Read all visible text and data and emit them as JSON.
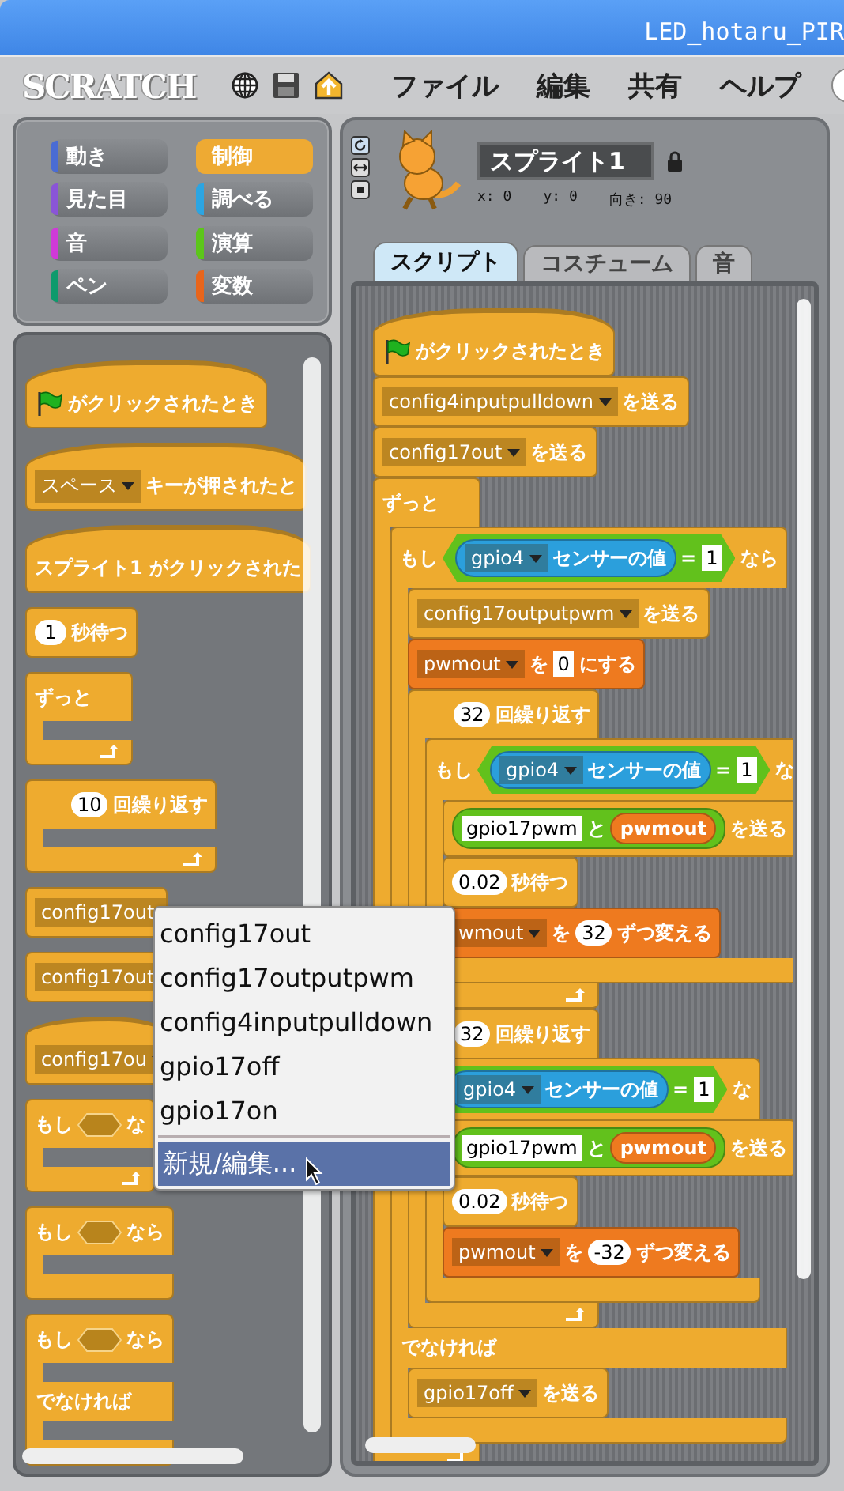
{
  "window": {
    "title": "LED_hotaru_PIR"
  },
  "menubar": {
    "logo": "SCRATCH",
    "menus": [
      "ファイル",
      "編集",
      "共有",
      "ヘルプ"
    ]
  },
  "categories": [
    {
      "label": "動き",
      "color": "#4a6cd4",
      "selected": false
    },
    {
      "label": "制御",
      "color": "#eeaa33",
      "selected": true
    },
    {
      "label": "見た目",
      "color": "#8a55d7",
      "selected": false
    },
    {
      "label": "調べる",
      "color": "#2ca5e2",
      "selected": false
    },
    {
      "label": "音",
      "color": "#cf3ad8",
      "selected": false
    },
    {
      "label": "演算",
      "color": "#5cc61a",
      "selected": false
    },
    {
      "label": "ペン",
      "color": "#0e9a6c",
      "selected": false
    },
    {
      "label": "変数",
      "color": "#e8651b",
      "selected": false
    }
  ],
  "palette": [
    {
      "kind": "hat",
      "color": "#eeab2f",
      "parts": [
        {
          "kind": "flag"
        },
        {
          "kind": "text",
          "text": "がクリックされたとき"
        }
      ]
    },
    {
      "kind": "hat",
      "color": "#eeab2f",
      "parts": [
        {
          "kind": "dropdown",
          "text": "スペース"
        },
        {
          "kind": "text",
          "text": "キーが押されたと"
        }
      ]
    },
    {
      "kind": "hat",
      "color": "#eeab2f",
      "parts": [
        {
          "kind": "text",
          "text": "スプライト1 がクリックされた"
        }
      ]
    },
    {
      "kind": "command",
      "color": "#eeab2f",
      "parts": [
        {
          "kind": "number",
          "text": "1"
        },
        {
          "kind": "text",
          "text": "秒待つ"
        }
      ]
    },
    {
      "kind": "loop",
      "color": "#eeab2f",
      "parts": [
        {
          "kind": "text",
          "text": "ずっと"
        }
      ]
    },
    {
      "kind": "loop",
      "color": "#eeab2f",
      "parts": [
        {
          "kind": "number",
          "text": "10"
        },
        {
          "kind": "text",
          "text": "回繰り返す"
        }
      ]
    },
    {
      "kind": "command",
      "color": "#eeab2f",
      "parts": [
        {
          "kind": "dropdown",
          "text": "config17out"
        }
      ]
    },
    {
      "kind": "command",
      "color": "#eeab2f",
      "parts": [
        {
          "kind": "dropdown",
          "text": "config17out"
        }
      ]
    },
    {
      "kind": "hat",
      "color": "#eeab2f",
      "parts": [
        {
          "kind": "dropdown",
          "text": "config17ou"
        }
      ]
    },
    {
      "kind": "loop",
      "color": "#eeab2f",
      "parts": [
        {
          "kind": "text",
          "text": "もし"
        },
        {
          "kind": "slot"
        },
        {
          "kind": "text",
          "text": "な"
        }
      ]
    },
    {
      "kind": "if",
      "color": "#eeab2f",
      "parts": [
        {
          "kind": "text",
          "text": "もし"
        },
        {
          "kind": "slot"
        },
        {
          "kind": "text",
          "text": "なら"
        }
      ]
    },
    {
      "kind": "ifelse",
      "color": "#eeab2f",
      "parts": [
        {
          "kind": "text",
          "text": "もし"
        },
        {
          "kind": "slot"
        },
        {
          "kind": "text",
          "text": "なら"
        }
      ],
      "else_label": "でなければ"
    }
  ],
  "sprite": {
    "name": "スプライト1",
    "x": "x: 0",
    "y": "y: 0",
    "direction": "向き: 90"
  },
  "tabs": [
    {
      "label": "スクリプト",
      "selected": true
    },
    {
      "label": "コスチューム",
      "selected": false
    },
    {
      "label": "音",
      "selected": false
    }
  ],
  "scripts": [
    {
      "kind": "hat",
      "color": "#eeab2f",
      "parts": [
        {
          "kind": "flag"
        },
        {
          "kind": "text",
          "text": "がクリックされたとき"
        }
      ]
    },
    {
      "kind": "command",
      "color": "#eeab2f",
      "parts": [
        {
          "kind": "dropdown",
          "text": "config4inputpulldown"
        },
        {
          "kind": "text",
          "text": "を送る"
        }
      ]
    },
    {
      "kind": "command",
      "color": "#eeab2f",
      "parts": [
        {
          "kind": "dropdown",
          "text": "config17out"
        },
        {
          "kind": "text",
          "text": "を送る"
        }
      ]
    },
    {
      "kind": "loop",
      "color": "#eeab2f",
      "parts": [
        {
          "kind": "text",
          "text": "ずっと"
        }
      ],
      "children": [
        {
          "kind": "ifelse",
          "color": "#eeab2f",
          "parts": [
            {
              "kind": "text",
              "text": "もし"
            },
            {
              "kind": "boolean",
              "color": "#62c11c",
              "parts": [
                {
                  "kind": "reporter",
                  "color": "#2b9fdc",
                  "parts": [
                    {
                      "kind": "dropdown",
                      "text": "gpio4"
                    },
                    {
                      "kind": "text",
                      "text": "センサーの値"
                    }
                  ]
                },
                {
                  "kind": "text",
                  "text": "="
                },
                {
                  "kind": "box",
                  "text": "1"
                }
              ]
            },
            {
              "kind": "text",
              "text": "なら"
            }
          ],
          "else_label": "でなければ",
          "children": [
            {
              "kind": "command",
              "color": "#eeab2f",
              "parts": [
                {
                  "kind": "dropdown",
                  "text": "config17outputpwm"
                },
                {
                  "kind": "text",
                  "text": "を送る"
                }
              ]
            },
            {
              "kind": "command",
              "color": "#ee7a1f",
              "parts": [
                {
                  "kind": "dropdown",
                  "text": "pwmout"
                },
                {
                  "kind": "text",
                  "text": "を"
                },
                {
                  "kind": "box",
                  "text": "0"
                },
                {
                  "kind": "text",
                  "text": "にする"
                }
              ]
            },
            {
              "kind": "loop",
              "color": "#eeab2f",
              "parts": [
                {
                  "kind": "number",
                  "text": "32"
                },
                {
                  "kind": "text",
                  "text": "回繰り返す"
                }
              ],
              "children": [
                {
                  "kind": "if",
                  "color": "#eeab2f",
                  "parts": [
                    {
                      "kind": "text",
                      "text": "もし"
                    },
                    {
                      "kind": "boolean",
                      "color": "#62c11c",
                      "parts": [
                        {
                          "kind": "reporter",
                          "color": "#2b9fdc",
                          "parts": [
                            {
                              "kind": "dropdown",
                              "text": "gpio4"
                            },
                            {
                              "kind": "text",
                              "text": "センサーの値"
                            }
                          ]
                        },
                        {
                          "kind": "text",
                          "text": "="
                        },
                        {
                          "kind": "box",
                          "text": "1"
                        }
                      ]
                    },
                    {
                      "kind": "text",
                      "text": "な"
                    }
                  ],
                  "children": [
                    {
                      "kind": "command",
                      "color": "#eeab2f",
                      "parts": [
                        {
                          "kind": "reporter",
                          "color": "#62c11c",
                          "parts": [
                            {
                              "kind": "box",
                              "text": "gpio17pwm"
                            },
                            {
                              "kind": "text",
                              "text": "と"
                            },
                            {
                              "kind": "reporter",
                              "color": "#ee7a1f",
                              "parts": [
                                {
                                  "kind": "text",
                                  "text": "pwmout"
                                }
                              ]
                            }
                          ]
                        },
                        {
                          "kind": "text",
                          "text": "を送る"
                        }
                      ]
                    },
                    {
                      "kind": "command",
                      "color": "#eeab2f",
                      "parts": [
                        {
                          "kind": "number",
                          "text": "0.02"
                        },
                        {
                          "kind": "text",
                          "text": "秒待つ"
                        }
                      ]
                    },
                    {
                      "kind": "command",
                      "color": "#ee7a1f",
                      "parts": [
                        {
                          "kind": "dropdown",
                          "text": "wmout"
                        },
                        {
                          "kind": "text",
                          "text": "を"
                        },
                        {
                          "kind": "number",
                          "text": "32"
                        },
                        {
                          "kind": "text",
                          "text": "ずつ変える"
                        }
                      ]
                    }
                  ]
                }
              ]
            },
            {
              "kind": "loop",
              "color": "#eeab2f",
              "parts": [
                {
                  "kind": "number",
                  "text": "32"
                },
                {
                  "kind": "text",
                  "text": "回繰り返す"
                }
              ],
              "children": [
                {
                  "kind": "if",
                  "color": "#eeab2f",
                  "parts": [
                    {
                      "kind": "boolean",
                      "color": "#62c11c",
                      "parts": [
                        {
                          "kind": "reporter",
                          "color": "#2b9fdc",
                          "parts": [
                            {
                              "kind": "dropdown",
                              "text": "gpio4"
                            },
                            {
                              "kind": "text",
                              "text": "センサーの値"
                            }
                          ]
                        },
                        {
                          "kind": "text",
                          "text": "="
                        },
                        {
                          "kind": "box",
                          "text": "1"
                        }
                      ]
                    },
                    {
                      "kind": "text",
                      "text": "な"
                    }
                  ],
                  "children": [
                    {
                      "kind": "command",
                      "color": "#eeab2f",
                      "parts": [
                        {
                          "kind": "reporter",
                          "color": "#62c11c",
                          "parts": [
                            {
                              "kind": "box",
                              "text": "gpio17pwm"
                            },
                            {
                              "kind": "text",
                              "text": "と"
                            },
                            {
                              "kind": "reporter",
                              "color": "#ee7a1f",
                              "parts": [
                                {
                                  "kind": "text",
                                  "text": "pwmout"
                                }
                              ]
                            }
                          ]
                        },
                        {
                          "kind": "text",
                          "text": "を送る"
                        }
                      ]
                    },
                    {
                      "kind": "command",
                      "color": "#eeab2f",
                      "parts": [
                        {
                          "kind": "number",
                          "text": "0.02"
                        },
                        {
                          "kind": "text",
                          "text": "秒待つ"
                        }
                      ]
                    },
                    {
                      "kind": "command",
                      "color": "#ee7a1f",
                      "parts": [
                        {
                          "kind": "dropdown",
                          "text": "pwmout"
                        },
                        {
                          "kind": "text",
                          "text": "を"
                        },
                        {
                          "kind": "number",
                          "text": "-32"
                        },
                        {
                          "kind": "text",
                          "text": "ずつ変える"
                        }
                      ]
                    }
                  ]
                }
              ]
            }
          ],
          "else_children": [
            {
              "kind": "command",
              "color": "#eeab2f",
              "parts": [
                {
                  "kind": "dropdown",
                  "text": "gpio17off"
                },
                {
                  "kind": "text",
                  "text": "を送る"
                }
              ]
            }
          ]
        }
      ]
    }
  ],
  "popup": {
    "items": [
      {
        "kind": "item",
        "label": "config17out",
        "selected": false
      },
      {
        "kind": "item",
        "label": "config17outputpwm",
        "selected": false
      },
      {
        "kind": "item",
        "label": "config4inputpulldown",
        "selected": false
      },
      {
        "kind": "item",
        "label": "gpio17off",
        "selected": false
      },
      {
        "kind": "item",
        "label": "gpio17on",
        "selected": false
      },
      {
        "kind": "separator"
      },
      {
        "kind": "item",
        "label": "新規/編集...",
        "selected": true
      }
    ]
  }
}
